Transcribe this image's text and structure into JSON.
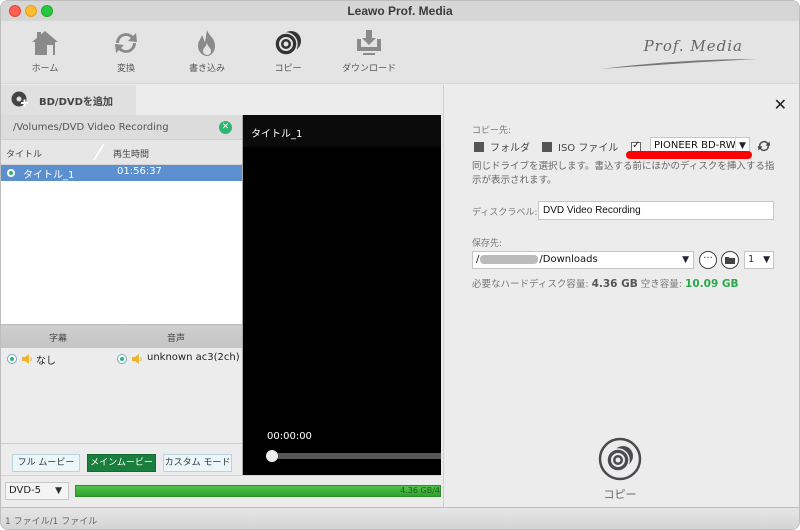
{
  "window": {
    "title": "Leawo Prof. Media"
  },
  "toolbar": {
    "items": [
      {
        "id": "home",
        "label": "ホーム",
        "icon": "home-icon"
      },
      {
        "id": "convert",
        "label": "変換",
        "icon": "convert-icon"
      },
      {
        "id": "burn",
        "label": "書き込み",
        "icon": "burn-icon"
      },
      {
        "id": "copy",
        "label": "コピー",
        "icon": "copy-disc-icon"
      },
      {
        "id": "download",
        "label": "ダウンロード",
        "icon": "download-icon"
      }
    ],
    "logo_text": "Prof. Media"
  },
  "source": {
    "add_button_label": "BD/DVDを追加",
    "path": "/Volumes/DVD Video Recording",
    "columns": {
      "title": "タイトル",
      "duration": "再生時間"
    },
    "titles": [
      {
        "title": "タイトル_1",
        "duration": "01:56:37",
        "selected": true
      }
    ],
    "tracks_header": {
      "subtitle": "字幕",
      "audio": "音声"
    },
    "subtitle_value": "なし",
    "audio_value": "unknown ac3(2ch)",
    "modes": [
      {
        "label": "フル ムービー",
        "active": false
      },
      {
        "label": "メインムービー",
        "active": true
      },
      {
        "label": "カスタム モード",
        "active": false
      }
    ]
  },
  "preview": {
    "title": "タイトル_1",
    "time": "00:00:00",
    "progress": 0
  },
  "bottom": {
    "disc_type": "DVD-5",
    "capacity_text": "4.36 GB/4",
    "capacity_fill_percent": 100
  },
  "status": {
    "text": "1 ファイル/1 ファイル"
  },
  "copy_panel": {
    "dest_label": "コピー先:",
    "opt_folder": "フォルダ",
    "opt_iso": "ISO ファイル",
    "folder_checked": false,
    "iso_checked": false,
    "drive_checked": true,
    "drive_value": "PIONEER BD-RW",
    "note": "同じドライブを選択します。書込する前にほかのディスクを挿入する指示が表示されます。",
    "disc_label_label": "ディスクラベル:",
    "disc_label_value": "DVD Video Recording",
    "save_label": "保存先:",
    "save_path_prefix": "/",
    "save_path_suffix": "/Downloads",
    "copies_value": "1",
    "required_label": "必要なハードディスク容量:",
    "required_value": "4.36 GB",
    "free_label": "空き容量:",
    "free_value": "10.09 GB",
    "copy_button_label": "コピー",
    "colors": {
      "accent_green": "#2aa84a",
      "highlight_red": "#ff0000",
      "selected_row": "#5b8fd0",
      "active_mode": "#1a7f3d"
    }
  }
}
